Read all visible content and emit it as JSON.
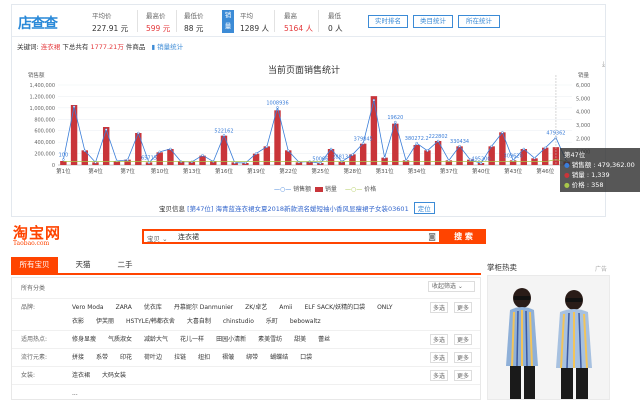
{
  "ext": {
    "logo": "店查查",
    "stats": [
      {
        "label": "平均价",
        "value": "227.91 元",
        "red": false
      },
      {
        "label": "最高价",
        "value": "599 元",
        "red": true
      },
      {
        "label": "最低价",
        "value": "88 元",
        "red": false
      }
    ],
    "sales_tag": "销量",
    "sales_stats": [
      {
        "label": "平均",
        "value": "1289 人",
        "red": false
      },
      {
        "label": "最高",
        "value": "5164 人",
        "red": true
      },
      {
        "label": "最低",
        "value": "0 人",
        "red": false
      }
    ],
    "buttons": [
      "实时排名",
      "类目统计",
      "所在统计"
    ],
    "keyword_prefix": "关键词:",
    "keyword": "连衣裙",
    "keyword_mid": "下总共有",
    "keyword_count": "1777.21万",
    "keyword_suffix": "件商品",
    "sales_stats_link": "销量统计",
    "download_icon": "download-icon",
    "info_prefix": "宝贝信息",
    "info_link": "[第47位] 海青蓝连衣裙女夏2018新款流名媛短袖小香风显瘦裙子女装03601",
    "locate_button": "定位",
    "tooltip": {
      "title": "第47位",
      "rows": [
        "销售额 : 479,362.00",
        "销量 : 1,339",
        "价格 : 358"
      ]
    }
  },
  "chart_data": {
    "type": "bar",
    "title": "当前页面销售统计",
    "ylabel_left": "销售额",
    "ylabel_right": "销量",
    "ylim_left": [
      0,
      1400000
    ],
    "ylim_right": [
      0,
      6000
    ],
    "yticks_left": [
      "0",
      "200,000",
      "400,000",
      "600,000",
      "800,000",
      "1,000,000",
      "1,200,000",
      "1,400,000"
    ],
    "yticks_right": [
      "0",
      "1,000",
      "2,000",
      "3,000",
      "4,000",
      "5,000",
      "6,000"
    ],
    "xticks": [
      "第1位",
      "第4位",
      "第7位",
      "第10位",
      "第13位",
      "第16位",
      "第19位",
      "第22位",
      "第25位",
      "第28位",
      "第31位",
      "第34位",
      "第37位",
      "第40位",
      "第43位",
      "第46位"
    ],
    "legend": [
      "销售额",
      "销量",
      "价格"
    ],
    "colors": {
      "revenue": "#3a7dd8",
      "sales": "#c9353a",
      "price": "#a8c64a"
    },
    "revenue": [
      95000,
      1020000,
      250000,
      45000,
      620000,
      70000,
      90000,
      560000,
      40000,
      230000,
      280000,
      58000,
      55000,
      170000,
      60000,
      520000,
      40000,
      35000,
      200000,
      320000,
      1008000,
      250000,
      50000,
      60000,
      30000,
      280000,
      60000,
      180000,
      379000,
      1135000,
      130000,
      750000,
      80000,
      382000,
      250000,
      420000,
      80000,
      330000,
      90000,
      30000,
      330000,
      570000,
      80000,
      280000,
      120000,
      300000,
      479000,
      60000
    ],
    "sales": [
      300,
      4500,
      1100,
      200,
      2850,
      300,
      400,
      2400,
      200,
      950,
      1200,
      300,
      250,
      700,
      300,
      2200,
      200,
      150,
      850,
      1400,
      4100,
      1100,
      200,
      250,
      150,
      1200,
      250,
      800,
      1600,
      5164,
      550,
      3100,
      350,
      1500,
      1100,
      1800,
      350,
      1400,
      400,
      150,
      1400,
      2450,
      350,
      1200,
      500,
      1300,
      1339,
      250
    ],
    "price": [
      228,
      228,
      228,
      228,
      228,
      228,
      228,
      228,
      228,
      228,
      228,
      228,
      228,
      228,
      228,
      228,
      228,
      228,
      228,
      228,
      228,
      228,
      228,
      228,
      228,
      228,
      228,
      228,
      228,
      228,
      228,
      228,
      228,
      228,
      228,
      228,
      228,
      228,
      228,
      228,
      228,
      228,
      228,
      228,
      228,
      228,
      358,
      228
    ],
    "point_labels": [
      {
        "i": 0,
        "text": "100"
      },
      {
        "i": 8,
        "text": "65715"
      },
      {
        "i": 15,
        "text": "522162"
      },
      {
        "i": 20,
        "text": "1008936"
      },
      {
        "i": 24,
        "text": "50066"
      },
      {
        "i": 26,
        "text": "288134"
      },
      {
        "i": 28,
        "text": "379845"
      },
      {
        "i": 31,
        "text": "19620"
      },
      {
        "i": 33,
        "text": "380272.2"
      },
      {
        "i": 35,
        "text": "222802"
      },
      {
        "i": 37,
        "text": "330434"
      },
      {
        "i": 39,
        "text": "495200"
      },
      {
        "i": 42,
        "text": "309620"
      },
      {
        "i": 46,
        "text": "479362"
      }
    ]
  },
  "taobao": {
    "logo": "淘宝网",
    "logo_sub": "Taobao.com",
    "search_category": "宝贝",
    "search_query": "连衣裙",
    "search_button": "搜 索",
    "camera_icon": "camera-icon",
    "tabs": [
      "所有宝贝",
      "天猫",
      "二手"
    ],
    "path": "所有分类",
    "sort_select": "收起筛选",
    "filters": [
      {
        "label": "品牌:",
        "options": [
          "Vero Moda",
          "ZARA",
          "优衣库",
          "丹慕妮尔 Danmunier",
          "ZK/卓艺",
          "Amii",
          "ELF SACK/妖精的口袋",
          "ONLY",
          "衣影",
          "伊芙丽",
          "HSTYLE/韩都衣舍",
          "大喜自制",
          "chinstudio",
          "乐町",
          "bebowaltz"
        ]
      },
      {
        "label": "适用热点:",
        "options": [
          "修身显瘦",
          "气质淑女",
          "减龄大气",
          "花儿一样",
          "田园小清新",
          "素美雪纺",
          "甜美",
          "蕾丝"
        ]
      },
      {
        "label": "流行元素:",
        "options": [
          "拼接",
          "系带",
          "印花",
          "荷叶边",
          "拉链",
          "纽扣",
          "褶皱",
          "绑带",
          "蝴蝶结",
          "口袋"
        ]
      },
      {
        "label": "女装:",
        "options": [
          "连衣裙",
          "大码女装"
        ]
      },
      {
        "label": "",
        "options": [
          "..."
        ]
      }
    ],
    "more_buttons": [
      "多选",
      "更多"
    ],
    "side_title": "掌柜热卖",
    "ad_label": "广告"
  }
}
